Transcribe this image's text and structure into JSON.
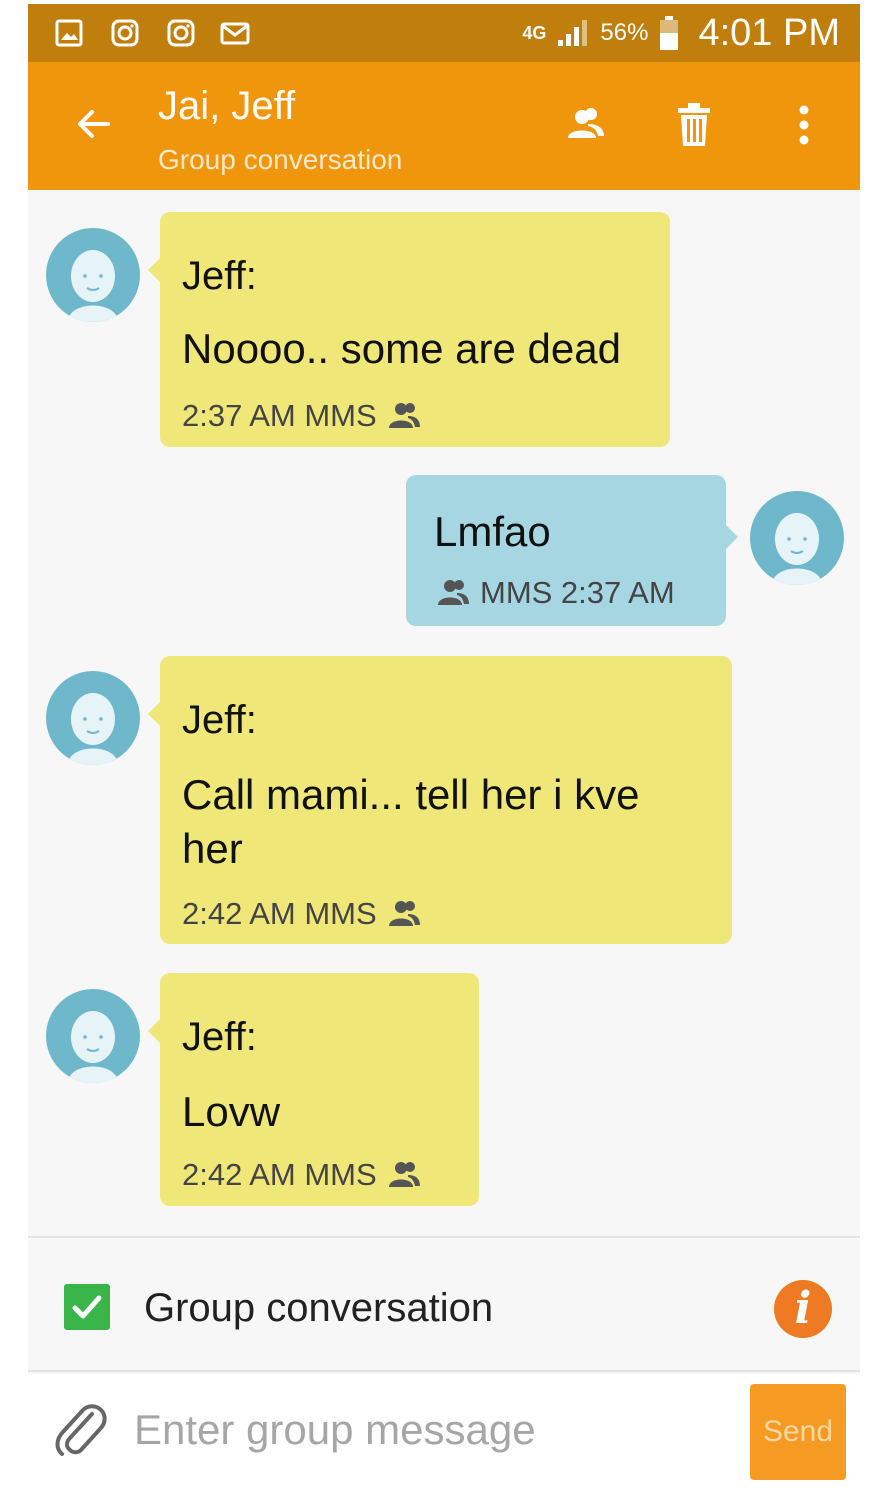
{
  "status_bar": {
    "network": "4G",
    "battery": "56%",
    "time": "4:01 PM",
    "notification_icons": [
      "gallery-icon",
      "instagram-icon",
      "instagram-icon",
      "mail-icon"
    ]
  },
  "app_bar": {
    "title": "Jai, Jeff",
    "subtitle": "Group conversation",
    "actions": [
      "group-members-icon",
      "delete-icon",
      "more-options-icon"
    ]
  },
  "messages": [
    {
      "direction": "incoming",
      "sender": "Jeff:",
      "text": "Noooo.. some are dead",
      "meta": "2:37 AM MMS"
    },
    {
      "direction": "outgoing",
      "text": "Lmfao",
      "meta": "MMS 2:37 AM"
    },
    {
      "direction": "incoming",
      "sender": "Jeff:",
      "text": "Call mami... tell her i kve her",
      "meta": "2:42 AM MMS"
    },
    {
      "direction": "incoming",
      "sender": "Jeff:",
      "text": "Lovw",
      "meta": "2:42 AM MMS"
    }
  ],
  "group_toggle": {
    "label": "Group conversation",
    "checked": true
  },
  "composer": {
    "placeholder": "Enter group message",
    "send_label": "Send"
  },
  "colors": {
    "status_bar": "#c07f0d",
    "app_bar": "#f0960d",
    "incoming_bubble": "#f0e779",
    "outgoing_bubble": "#a7d6e3",
    "checkbox": "#39b54a",
    "info": "#ee7a24",
    "send": "#f59a22"
  }
}
